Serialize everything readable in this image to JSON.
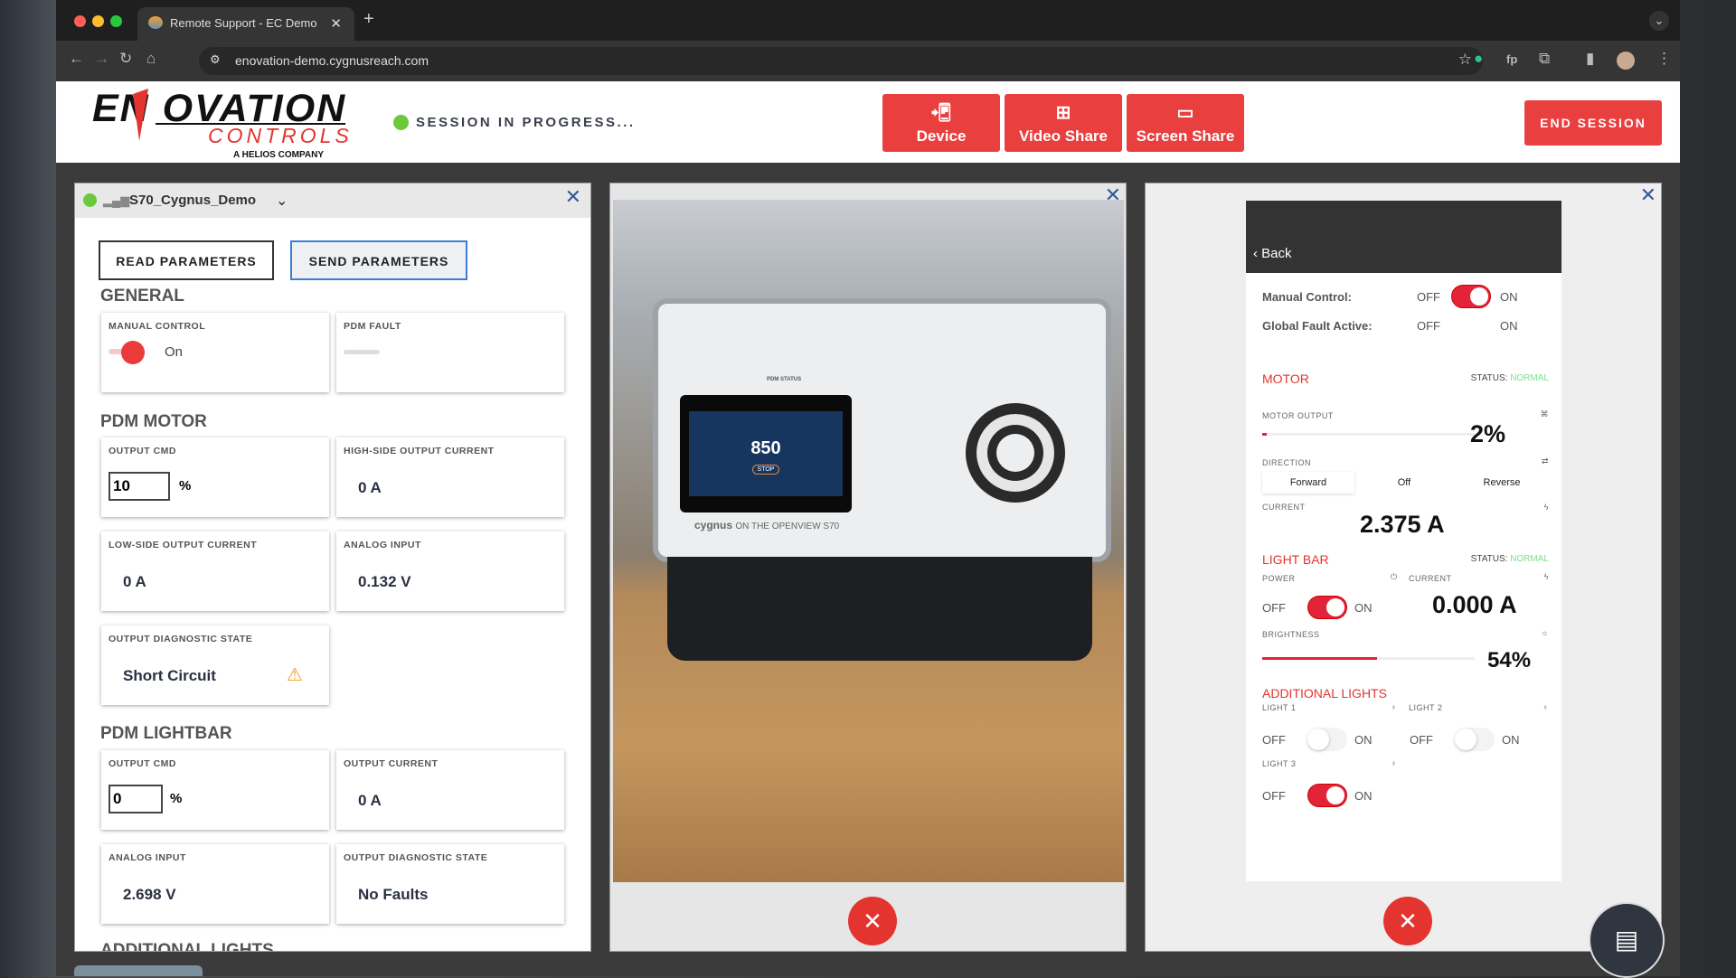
{
  "browser": {
    "tab_title": "Remote Support - EC Demo",
    "url": "enovation-demo.cygnusreach.com"
  },
  "header": {
    "logo_main": "ENOVATION",
    "logo_sub": "CONTROLS",
    "logo_tag": "A HELIOS COMPANY",
    "session_status": "SESSION IN PROGRESS...",
    "status_color": "#6cc93a",
    "tools": [
      {
        "label": "Device",
        "icon": "device-download-icon"
      },
      {
        "label": "Video Share",
        "icon": "video-add-icon"
      },
      {
        "label": "Screen Share",
        "icon": "screen-share-icon"
      }
    ],
    "end_session": "END SESSION",
    "accent": "#e93f3f"
  },
  "left_panel": {
    "device_name": "S70_Cygnus_Demo",
    "read_btn": "READ PARAMETERS",
    "send_btn": "SEND PARAMETERS",
    "sections": {
      "general": "GENERAL",
      "motor": "PDM MOTOR",
      "lightbar": "PDM LIGHTBAR",
      "additional": "ADDITIONAL LIGHTS"
    },
    "manual_control": {
      "label": "MANUAL CONTROL",
      "state": "On"
    },
    "pdm_fault": {
      "label": "PDM FAULT"
    },
    "motor": {
      "output_cmd_label": "OUTPUT CMD",
      "output_cmd": "10",
      "unit": "%",
      "high_side_label": "HIGH-SIDE OUTPUT CURRENT",
      "high_side": "0 A",
      "low_side_label": "LOW-SIDE OUTPUT CURRENT",
      "low_side": "0 A",
      "analog_label": "ANALOG INPUT",
      "analog": "0.132 V",
      "diag_label": "OUTPUT DIAGNOSTIC STATE",
      "diag": "Short Circuit"
    },
    "lightbar": {
      "output_cmd_label": "OUTPUT CMD",
      "output_cmd": "0",
      "unit": "%",
      "current_label": "OUTPUT CURRENT",
      "current": "0 A",
      "analog_label": "ANALOG INPUT",
      "analog": "2.698 V",
      "diag_label": "OUTPUT DIAGNOSTIC STATE",
      "diag": "No Faults"
    }
  },
  "video": {
    "brand": "cygnus",
    "brand_tag": "ON THE OPENVIEW S70",
    "rpm": "850",
    "stop": "STOP",
    "pdm_status": "PDM STATUS"
  },
  "screen": {
    "back": "Back",
    "manual_control": "Manual Control:",
    "global_fault": "Global Fault Active:",
    "off": "OFF",
    "on": "ON",
    "motor": {
      "title": "MOTOR",
      "status_label": "STATUS:",
      "status": "NORMAL",
      "output_label": "MOTOR OUTPUT",
      "output": "2%",
      "output_value": 2,
      "direction_label": "DIRECTION",
      "directions": [
        "Forward",
        "Off",
        "Reverse"
      ],
      "selected": "Forward",
      "current_label": "CURRENT",
      "current": "2.375 A"
    },
    "lightbar": {
      "title": "LIGHT BAR",
      "status_label": "STATUS:",
      "status": "NORMAL",
      "power_label": "POWER",
      "current_label": "CURRENT",
      "current": "0.000 A",
      "brightness_label": "BRIGHTNESS",
      "brightness": "54%",
      "brightness_value": 54
    },
    "additional": {
      "title": "ADDITIONAL LIGHTS",
      "light1": "LIGHT 1",
      "light2": "LIGHT 2",
      "light3": "LIGHT 3"
    },
    "status_color": "#7ee08a"
  }
}
